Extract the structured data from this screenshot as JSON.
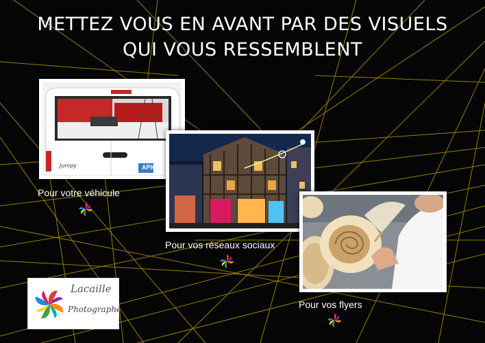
{
  "headline": {
    "line1": "METTEZ VOUS EN AVANT PAR DES VISUELS",
    "line2": "QUI VOUS RESSEMBLENT"
  },
  "captions": {
    "vehicle": "Pour votre véhicule",
    "social": "Pour vos réseaux sociaux",
    "flyers": "Pour vos flyers"
  },
  "vehicle_photo": {
    "van_badge": "Jumpy",
    "van_sticker": "APIC"
  },
  "logo": {
    "name": "Lacaille",
    "tagline": "Photographe"
  },
  "colors": {
    "background": "#050505",
    "grid_lines": "#c8a800",
    "text": "#ffffff"
  },
  "icons": {
    "pin": "pinwheel-icon",
    "logo_mark": "pinwheel-logo"
  }
}
